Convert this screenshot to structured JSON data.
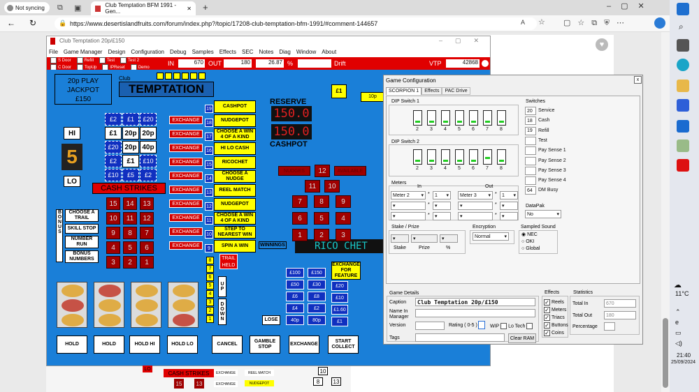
{
  "browser": {
    "not_syncing": "Not syncing",
    "tab_title": "Club Temptation BFM 1991 - Gen...",
    "new_tab": "+",
    "url": "https://www.desertislandfruits.com/forum/index.php?/topic/17208-club-temptation-bfm-1991/#comment-144657"
  },
  "emu": {
    "title": "Club Temptation 20p/£150",
    "menu": [
      "File",
      "Game Manager",
      "Design",
      "Configuration",
      "Debug",
      "Samples",
      "Effects",
      "SEC",
      "Notes",
      "Diag",
      "Window",
      "About"
    ],
    "flags_top": [
      "S Door",
      "Refill",
      "Test",
      "Test 2"
    ],
    "flags_bottom": [
      "C Door",
      "TopUp",
      "IPReset",
      "Demo"
    ],
    "in_label": "IN",
    "in_value": "670",
    "out_label": "OUT",
    "out_value": "180",
    "pct_value": "26.87",
    "pct_label": "%",
    "drift_label": "Drift",
    "vtp_label": "VTP",
    "vtp_value": "42868"
  },
  "game": {
    "jackpot": [
      "20p PLAY",
      "JACKPOT",
      "£150"
    ],
    "club": "Club",
    "temptation": "TEMPTATION",
    "hi": "HI",
    "lo": "LO",
    "five": "5",
    "prize_grid": [
      [
        "£2",
        "£1",
        "£20"
      ],
      [
        "£1",
        "20p",
        "20p"
      ],
      [
        "£20",
        "20p",
        "40p"
      ],
      [
        "£2",
        "£1",
        "£10"
      ],
      [
        "£10",
        "£5",
        "£2"
      ]
    ],
    "cash_strikes": "CASH STRIKES",
    "red_grid": [
      [
        "15",
        "14",
        "13"
      ],
      [
        "10",
        "11",
        "12"
      ],
      [
        "9",
        "8",
        "7"
      ],
      [
        "4",
        "5",
        "6"
      ],
      [
        "3",
        "2",
        "1"
      ]
    ],
    "bonus_label": "BONUS",
    "bonus_buttons": [
      "CHOOSE A TRAIL",
      "SKILL STOP",
      "NUMBER RUN",
      "BONUS NUMBERS"
    ],
    "exchange": "EXCHANGE",
    "trail_nums": [
      "19",
      "18",
      "17",
      "16",
      "15",
      "14",
      "13",
      "12",
      "11",
      "10",
      "9"
    ],
    "trail_items": [
      "CASHPOT",
      "NUDGEPOT",
      "CHOOSE A WIN 4 OF A KIND",
      "HI LO CASH",
      "RICOCHET",
      "CHOOSE A NUDGE",
      "REEL MATCH",
      "NUDGEPOT",
      "CHOOSE A WIN 4 OF A KIND",
      "STEP TO NEAREST WIN",
      "SPIN A WIN"
    ],
    "reserve": "RESERVE",
    "reserve_val": "150.0",
    "cashpot_val": "150.0",
    "cashpot": "CASHPOT",
    "gold": "£1",
    "ten_p": "10p",
    "nudges": "NUDGES",
    "nudge_num": "12",
    "available": "AVAILABLE",
    "right_grid": [
      [
        "11",
        "10"
      ],
      [
        "7",
        "8",
        "9"
      ],
      [
        "6",
        "5",
        "4"
      ],
      [
        "1",
        "2",
        "3"
      ]
    ],
    "winnings": "WINNINGS",
    "dot_display": "RICO CHET",
    "trail_held": "TRAIL HELD",
    "up": "UP",
    "down": "DOWN",
    "ynums": [
      "8",
      "7",
      "6",
      "5",
      "4",
      "3",
      "2",
      "1"
    ],
    "money": [
      [
        "£100",
        "£150"
      ],
      [
        "£50",
        "£30"
      ],
      [
        "£6",
        "£8"
      ],
      [
        "£4",
        "£2"
      ],
      [
        "40p",
        "80p"
      ]
    ],
    "money_right": [
      "£20",
      "£10",
      "£1.60",
      "£1"
    ],
    "exchange_feature": "EXCHANGE FOR FEATURE",
    "lose": "LOSE",
    "bottom_buttons": [
      "HOLD",
      "HOLD",
      "HOLD HI",
      "HOLD LO",
      "CANCEL",
      "GAMBLE STOP",
      "EXCHANGE",
      "START COLLECT"
    ],
    "under_strip": [
      "LO",
      "CASH STRIKES",
      "15",
      "13",
      "EXCHANGE",
      "REEL MATCH",
      "10",
      "EXCHANGE",
      "NUDGEPOT",
      "8",
      "13"
    ]
  },
  "config": {
    "title": "Game Configuration",
    "close": "x",
    "tabs": [
      "SCORPION 1",
      "Effects",
      "PAC Drive"
    ],
    "dip1": "DIP Switch 1",
    "dip2": "DIP Switch 2",
    "dip_nums": [
      "2",
      "3",
      "4",
      "5",
      "6",
      "7",
      "8"
    ],
    "switches_label": "Switches",
    "switches": [
      {
        "val": "20",
        "label": "Service"
      },
      {
        "val": "18",
        "label": "Cash"
      },
      {
        "val": "19",
        "label": "Refill"
      },
      {
        "val": "",
        "label": "Test"
      },
      {
        "val": "",
        "label": "Pay Sense 1"
      },
      {
        "val": "",
        "label": "Pay Sense 2"
      },
      {
        "val": "",
        "label": "Pay Sense 3"
      },
      {
        "val": "",
        "label": "Pay Sense 4"
      },
      {
        "val": "64",
        "label": "DM Busy"
      }
    ],
    "meters_label": "Meters",
    "in_label": "In",
    "out_label": "Out",
    "meter_in": "Meter 2",
    "meter_in_x": "1",
    "meter_out": "Meter 3",
    "meter_out_x": "1",
    "times": "*",
    "datapak_label": "DataPak",
    "datapak_val": "No",
    "stake_label": "Stake / Prize",
    "stake": "Stake",
    "prize": "Prize",
    "pct": "%",
    "encryption_label": "Encryption",
    "encryption_val": "Normal",
    "sampled_label": "Sampled Sound",
    "sound_options": [
      "NEC",
      "OKI",
      "Global"
    ],
    "details_label": "Game Details",
    "caption_label": "Caption",
    "caption_val": "Club Temptation 20p/£150",
    "name_label": "Name In Manager",
    "version_label": "Version",
    "rating_label": "Rating ( 0-5 )",
    "wip_label": "WIP",
    "lotech_label": "Lo Tech",
    "tags_label": "Tags",
    "clear_ram": "Clear RAM",
    "effects_label": "Effects",
    "effects": [
      "Reels",
      "Meters",
      "Triacs",
      "Buttons",
      "Coins"
    ],
    "stats_label": "Statistics",
    "total_in_label": "Total In",
    "total_in": "670",
    "total_out_label": "Total Out",
    "total_out": "180",
    "percentage_label": "Percentage"
  },
  "taskbar": {
    "temp": "11°C",
    "time": "21:40",
    "date": "25/09/2024"
  }
}
